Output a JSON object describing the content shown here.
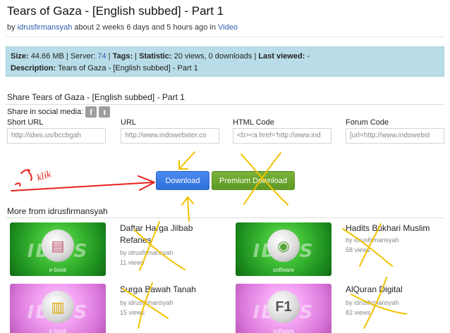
{
  "page": {
    "title": "Tears of Gaza - [English subbed] - Part 1",
    "byline": {
      "by": "by",
      "user": "idrusfirmansyah",
      "ago": "about 2 weeks 6 days and 5 hours ago in",
      "category": "Video"
    }
  },
  "info": {
    "size_label": "Size:",
    "size": "44.66 MB",
    "server_label": "Server:",
    "server": "74",
    "tags_label": "Tags:",
    "statistic_label": "Statistic:",
    "statistic": "20 views, 0 downloads",
    "last_viewed_label": "Last viewed:",
    "last_viewed": "-",
    "description_label": "Description:",
    "description": "Tears of Gaza - [English subbed] - Part 1"
  },
  "share": {
    "title": "Share Tears of Gaza - [English subbed] - Part 1",
    "social_label": "Share in social media:",
    "social_icons": [
      "facebook-icon",
      "twitter-icon"
    ],
    "facebook_glyph": "f",
    "twitter_glyph": "t",
    "fields": [
      {
        "label": "Short URL",
        "value": "http://idws.us/bccbgah"
      },
      {
        "label": "URL",
        "value": "http://www.indowebster.co"
      },
      {
        "label": "HTML Code",
        "value": "<b><a href='http://www.ind"
      },
      {
        "label": "Forum Code",
        "value": "[url=http://www.indowebst"
      }
    ]
  },
  "buttons": {
    "download": "Download",
    "premium": "Premium Download"
  },
  "annotation": {
    "text": "klik",
    "color": "#e8211d"
  },
  "more": {
    "title": "More from idrusfirmansyah",
    "items": [
      {
        "title": "Daftar Harga Jilbab Refanes",
        "user": "idrusfirmansyah",
        "views": "11 views",
        "category": "e-book",
        "thumb": "green"
      },
      {
        "title": "Hadits Bukhari Muslim",
        "user": "idrusfirmansyah",
        "views": "58 views",
        "category": "software",
        "thumb": "green"
      },
      {
        "title": "Surga Bawah Tanah",
        "user": "idrusfirmansyah",
        "views": "15 views",
        "category": "e-book",
        "thumb": "pink"
      },
      {
        "title": "AlQuran Digital",
        "user": "idrusfirmansyah",
        "views": "82 views",
        "category": "software",
        "thumb": "pink"
      }
    ],
    "by_prefix": "by"
  },
  "colors": {
    "info_bg": "#b9dde8",
    "link": "#2a5db0",
    "download_btn": "#2f6fdc",
    "premium_btn": "#5e9a24",
    "scribble_yellow": "#f2c200"
  },
  "thumb_brand": "IDWS",
  "emblem_glyphs": {
    "ebook": "▤",
    "software": "◉",
    "book": "▥",
    "f1": "F1"
  }
}
